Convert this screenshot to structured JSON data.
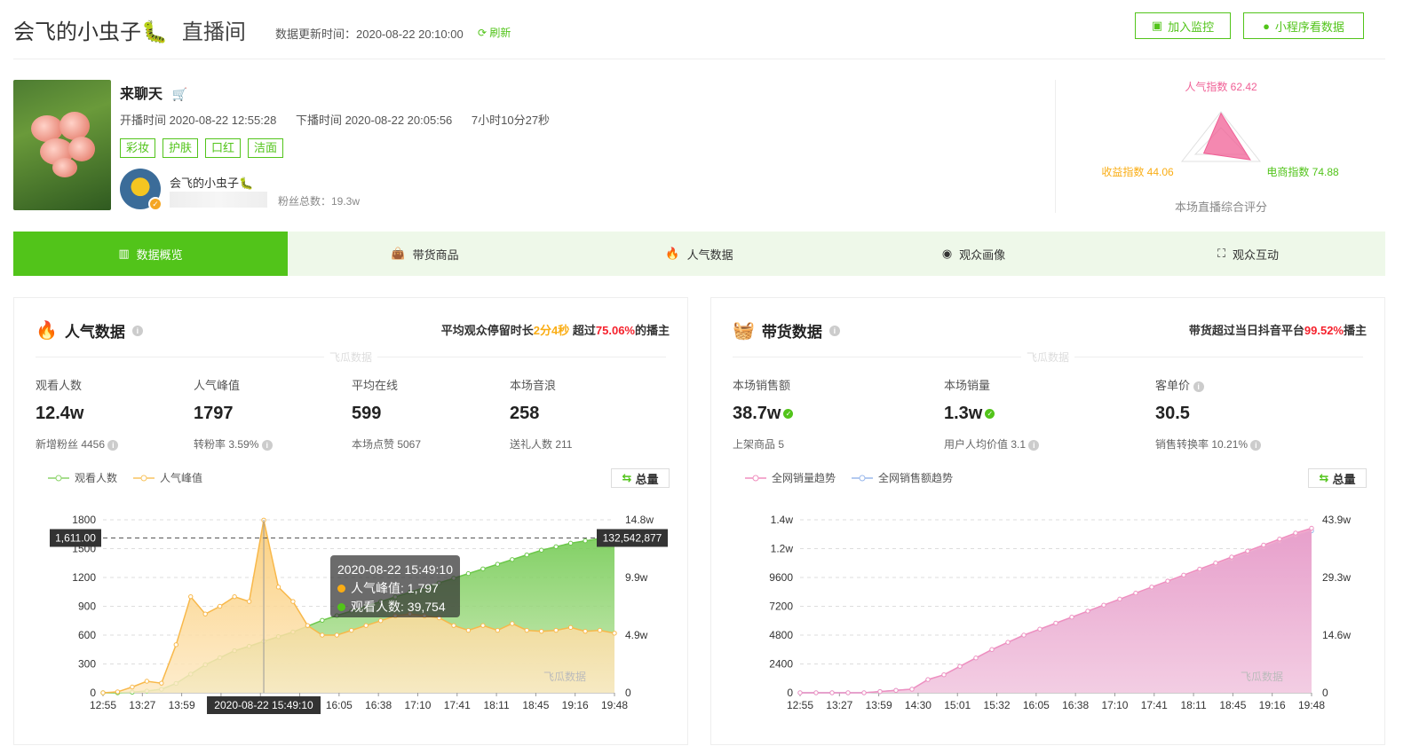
{
  "header": {
    "title": "会飞的小虫子🐛",
    "subtitle": "直播间",
    "update_label": "数据更新时间：2020-08-22 20:10:00",
    "refresh": "刷新",
    "btn_monitor": "加入监控",
    "btn_mini": "小程序看数据"
  },
  "live": {
    "name": "来聊天",
    "start": "开播时间 2020-08-22 12:55:28",
    "end": "下播时间 2020-08-22 20:05:56",
    "duration": "7小时10分27秒",
    "tags": [
      "彩妆",
      "护肤",
      "口红",
      "洁面"
    ],
    "account_name": "会飞的小虫子🐛",
    "fans": "粉丝总数：19.3w"
  },
  "radar": {
    "pop": "人气指数 62.42",
    "income": "收益指数 44.06",
    "ecom": "电商指数 74.88",
    "caption": "本场直播综合评分",
    "values": {
      "pop": 62.42,
      "income": 44.06,
      "ecom": 74.88
    }
  },
  "tabs": [
    "数据概览",
    "带货商品",
    "人气数据",
    "观众画像",
    "观众互动"
  ],
  "colors": {
    "accent": "#52c41a",
    "orange": "#faad14",
    "red": "#f5222d",
    "pink": "#e86aa6",
    "purple": "#8f8fe8"
  },
  "pop_card": {
    "title": "人气数据",
    "summary_pre": "平均观众停留时长",
    "summary_val": "2分4秒",
    "summary_mid": " 超过",
    "summary_pct": "75.06%",
    "summary_post": "的播主",
    "watermark": "飞瓜数据",
    "metrics": [
      {
        "label": "观看人数",
        "value": "12.4w",
        "sub": "新增粉丝 4456"
      },
      {
        "label": "人气峰值",
        "value": "1797",
        "sub": "转粉率 3.59%"
      },
      {
        "label": "平均在线",
        "value": "599",
        "sub": "本场点赞 5067"
      },
      {
        "label": "本场音浪",
        "value": "258",
        "sub": "送礼人数 211"
      }
    ],
    "legend": [
      "观看人数",
      "人气峰值"
    ],
    "total_btn": "总量",
    "tooltip": {
      "time": "2020-08-22 15:49:10",
      "peak": "人气峰值: 1,797",
      "viewers": "观看人数: 39,754"
    },
    "cursor_label": "2020-08-22 15:49:10",
    "left_marker": "1,611.00",
    "right_marker": "132,542,877"
  },
  "sales_card": {
    "title": "带货数据",
    "summary_pre": "带货超过当日抖音平台",
    "summary_pct": "99.52%",
    "summary_post": "播主",
    "watermark": "飞瓜数据",
    "metrics": [
      {
        "label": "本场销售额",
        "value": "38.7w",
        "sub": "上架商品 5"
      },
      {
        "label": "本场销量",
        "value": "1.3w",
        "sub": "用户人均价值 3.1"
      },
      {
        "label": "客单价",
        "value": "30.5",
        "sub": "销售转换率 10.21%"
      }
    ],
    "legend": [
      "全网销量趋势",
      "全网销售额趋势"
    ],
    "total_btn": "总量"
  },
  "chart_data": [
    {
      "type": "area",
      "x": [
        "12:55",
        "13:27",
        "13:59",
        "14:30",
        "15:01",
        "15:32",
        "16:05",
        "16:38",
        "17:10",
        "17:41",
        "18:11",
        "18:45",
        "19:16",
        "19:48"
      ],
      "y_left_ticks": [
        "0",
        "300",
        "600",
        "900",
        "1200",
        "1500",
        "1800"
      ],
      "y_right_ticks": [
        "0",
        "4.9w",
        "9.9w",
        "14.8w"
      ],
      "ylim_left": [
        0,
        1800
      ],
      "ylim_right": [
        0,
        148000
      ],
      "series": [
        {
          "name": "人气峰值",
          "axis": "left",
          "values": [
            0,
            10,
            60,
            120,
            100,
            500,
            1000,
            820,
            900,
            1000,
            950,
            1797,
            1100,
            950,
            700,
            600,
            600,
            650,
            700,
            750,
            800,
            820,
            800,
            780,
            700,
            650,
            700,
            650,
            720,
            650,
            640,
            650,
            680,
            640,
            650,
            620
          ]
        },
        {
          "name": "观看人数",
          "axis": "right",
          "values": [
            0,
            0,
            500,
            1500,
            3000,
            8000,
            16000,
            24000,
            30000,
            36000,
            39754,
            44000,
            48000,
            52000,
            57000,
            62000,
            66000,
            70000,
            74000,
            78000,
            82000,
            86000,
            90000,
            94000,
            98000,
            102000,
            106000,
            110000,
            114000,
            118000,
            122000,
            125000,
            128000,
            130000,
            132000,
            133000
          ]
        }
      ]
    },
    {
      "type": "area",
      "x": [
        "12:55",
        "13:27",
        "13:59",
        "14:30",
        "15:01",
        "15:32",
        "16:05",
        "16:38",
        "17:10",
        "17:41",
        "18:11",
        "18:45",
        "19:16",
        "19:48"
      ],
      "y_left_ticks": [
        "0",
        "2400",
        "4800",
        "7200",
        "9600",
        "1.2w",
        "1.4w"
      ],
      "y_right_ticks": [
        "0",
        "14.6w",
        "29.3w",
        "43.9w"
      ],
      "ylim_left": [
        0,
        14400
      ],
      "ylim_right": [
        0,
        439000
      ],
      "series": [
        {
          "name": "全网销量趋势",
          "axis": "left",
          "values": [
            0,
            0,
            0,
            0,
            0,
            100,
            200,
            300,
            1100,
            1500,
            2200,
            2900,
            3600,
            4200,
            4800,
            5300,
            5800,
            6300,
            6800,
            7300,
            7800,
            8300,
            8800,
            9300,
            9800,
            10300,
            10800,
            11300,
            11800,
            12300,
            12800,
            13300,
            13700
          ]
        },
        {
          "name": "全网销售额趋势",
          "axis": "right",
          "values": [
            0,
            0,
            0,
            0,
            0,
            3000,
            6000,
            9000,
            33000,
            45000,
            66000,
            87000,
            108000,
            126000,
            144000,
            159000,
            174000,
            189000,
            204000,
            219000,
            234000,
            249000,
            264000,
            279000,
            294000,
            309000,
            324000,
            339000,
            354000,
            369000,
            384000,
            399000,
            411000
          ]
        }
      ]
    }
  ]
}
